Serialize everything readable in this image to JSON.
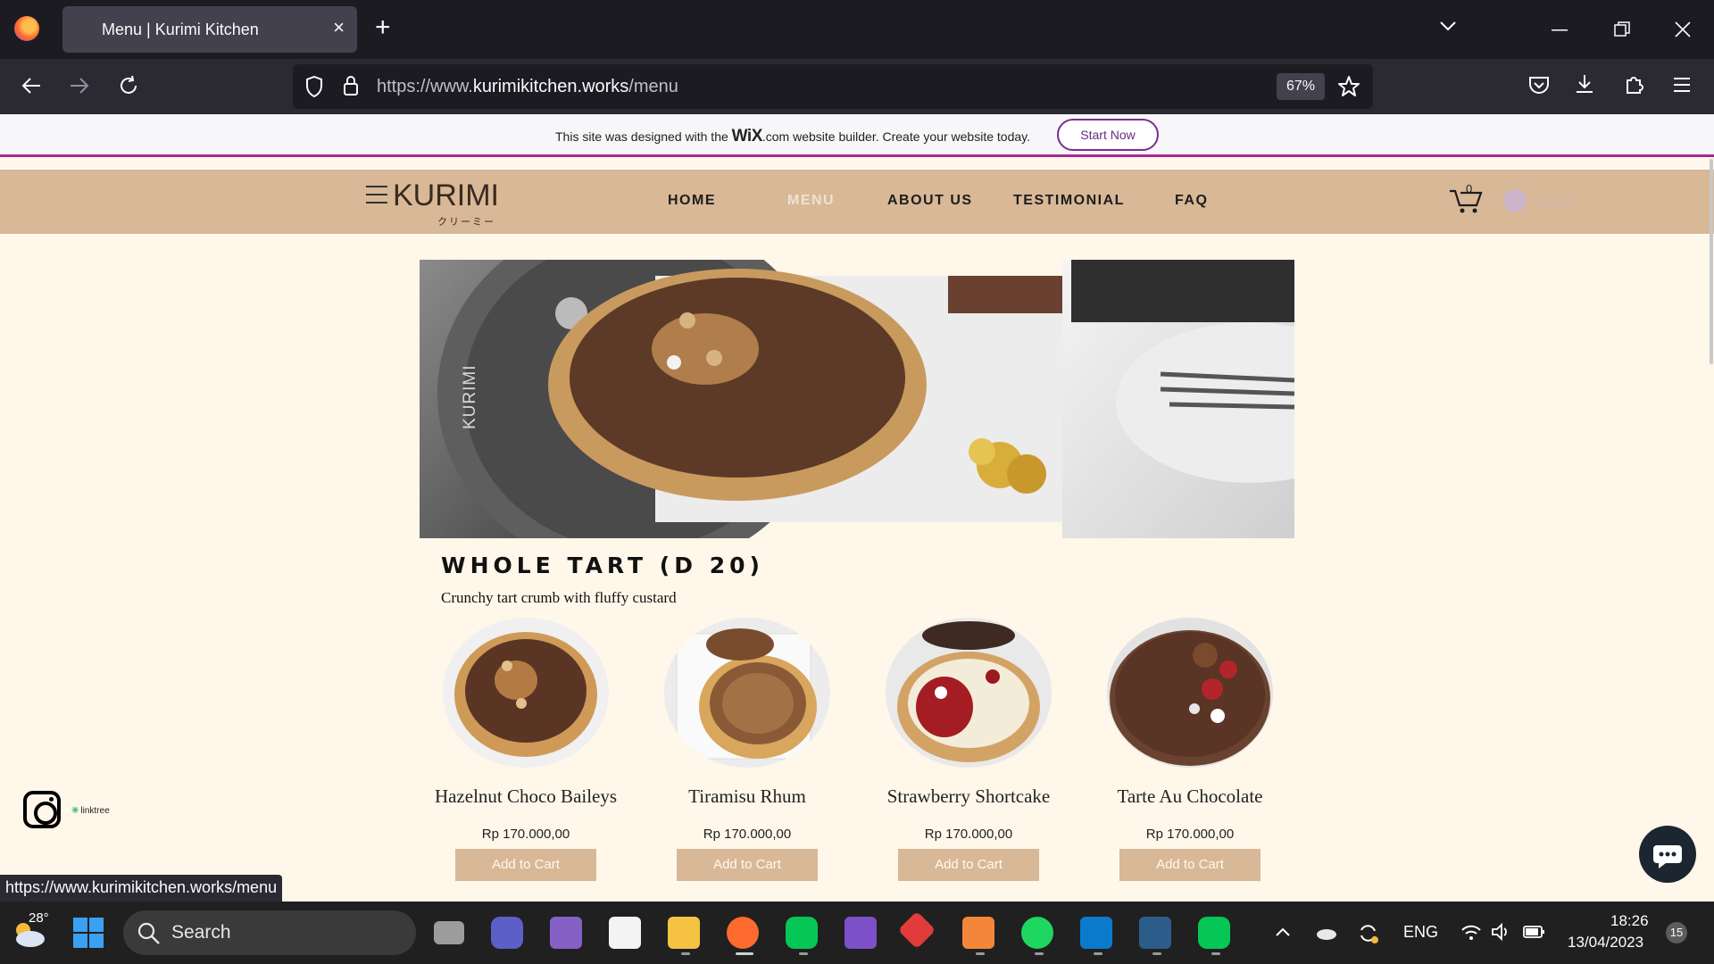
{
  "browser": {
    "tab_title": "Menu | Kurimi Kitchen",
    "tab_close": "×",
    "new_tab": "+",
    "url_prefix": "https://www.",
    "url_domain": "kurimikitchen.works",
    "url_path": "/menu",
    "zoom": "67%",
    "status_url": "https://www.kurimikitchen.works/menu"
  },
  "wix_banner": {
    "text_before": "This site was designed with the",
    "logo": "WiX",
    "logo_suffix": ".com",
    "text_after": "website builder. Create your website today.",
    "button": "Start Now"
  },
  "site": {
    "brand": "KURIMI",
    "brand_sub": "クリーミー",
    "nav": [
      "HOME",
      "MENU",
      "ABOUT US",
      "TESTIMONIAL",
      "FAQ"
    ],
    "active_nav": "MENU",
    "cart_count": "0",
    "login": "Log In",
    "hero_watermark": "KURIMI"
  },
  "section": {
    "title": "WHOLE TART (D 20)",
    "subtitle": "Crunchy tart crumb with fluffy custard"
  },
  "products": [
    {
      "name": "Hazelnut Choco Baileys",
      "price": "Rp 170.000,00",
      "button": "Add to Cart"
    },
    {
      "name": "Tiramisu Rhum",
      "price": "Rp 170.000,00",
      "button": "Add to Cart"
    },
    {
      "name": "Strawberry Shortcake",
      "price": "Rp 170.000,00",
      "button": "Add to Cart"
    },
    {
      "name": "Tarte Au Chocolate",
      "price": "Rp 170.000,00",
      "button": "Add to Cart"
    }
  ],
  "social": {
    "linktree": "linktree"
  },
  "taskbar": {
    "temperature": "28°",
    "search": "Search",
    "language": "ENG",
    "time": "18:26",
    "date": "13/04/2023",
    "notifications": "15"
  }
}
